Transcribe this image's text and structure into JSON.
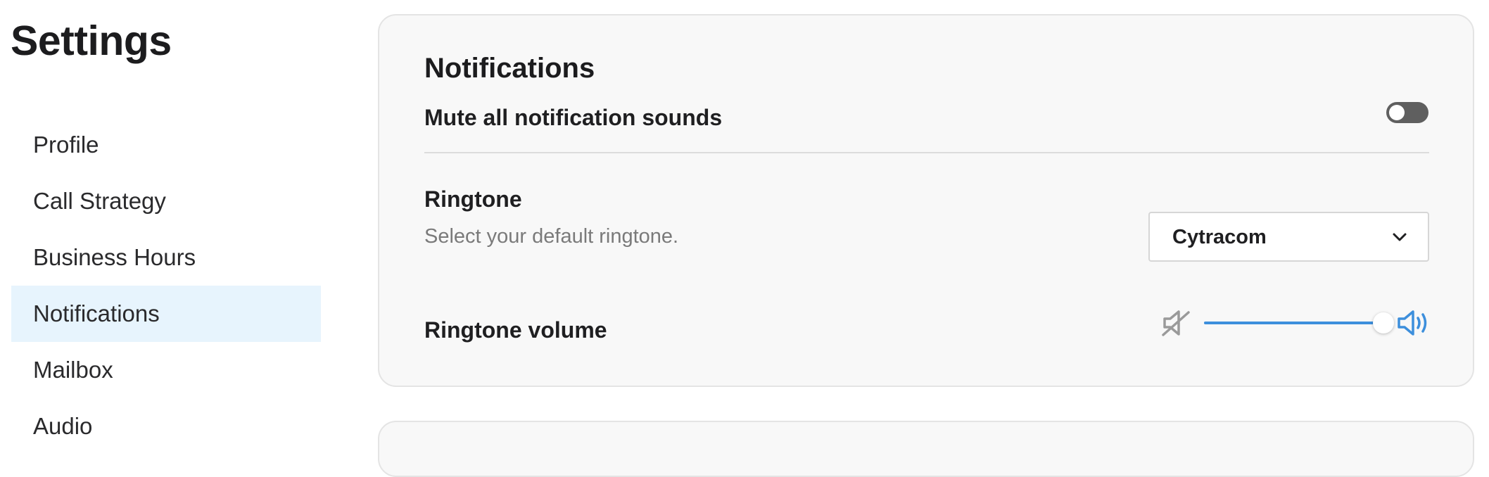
{
  "page": {
    "title": "Settings"
  },
  "sidebar": {
    "items": [
      {
        "label": "Profile",
        "active": false
      },
      {
        "label": "Call Strategy",
        "active": false
      },
      {
        "label": "Business Hours",
        "active": false
      },
      {
        "label": "Notifications",
        "active": true
      },
      {
        "label": "Mailbox",
        "active": false
      },
      {
        "label": "Audio",
        "active": false
      }
    ]
  },
  "notifications": {
    "title": "Notifications",
    "mute": {
      "label": "Mute all notification sounds",
      "enabled": false
    },
    "ringtone": {
      "label": "Ringtone",
      "description": "Select your default ringtone.",
      "selected": "Cytracom"
    },
    "volume": {
      "label": "Ringtone volume",
      "value_percent": 100
    }
  },
  "colors": {
    "active_sidebar_bg": "#e7f4fd",
    "accent": "#3d8fdc",
    "toggle_off": "#5f5f5f",
    "card_bg": "#f8f8f8"
  },
  "icons": {
    "mute": "speaker-muted-icon",
    "volume": "speaker-loud-icon",
    "chevron": "chevron-down-icon"
  }
}
